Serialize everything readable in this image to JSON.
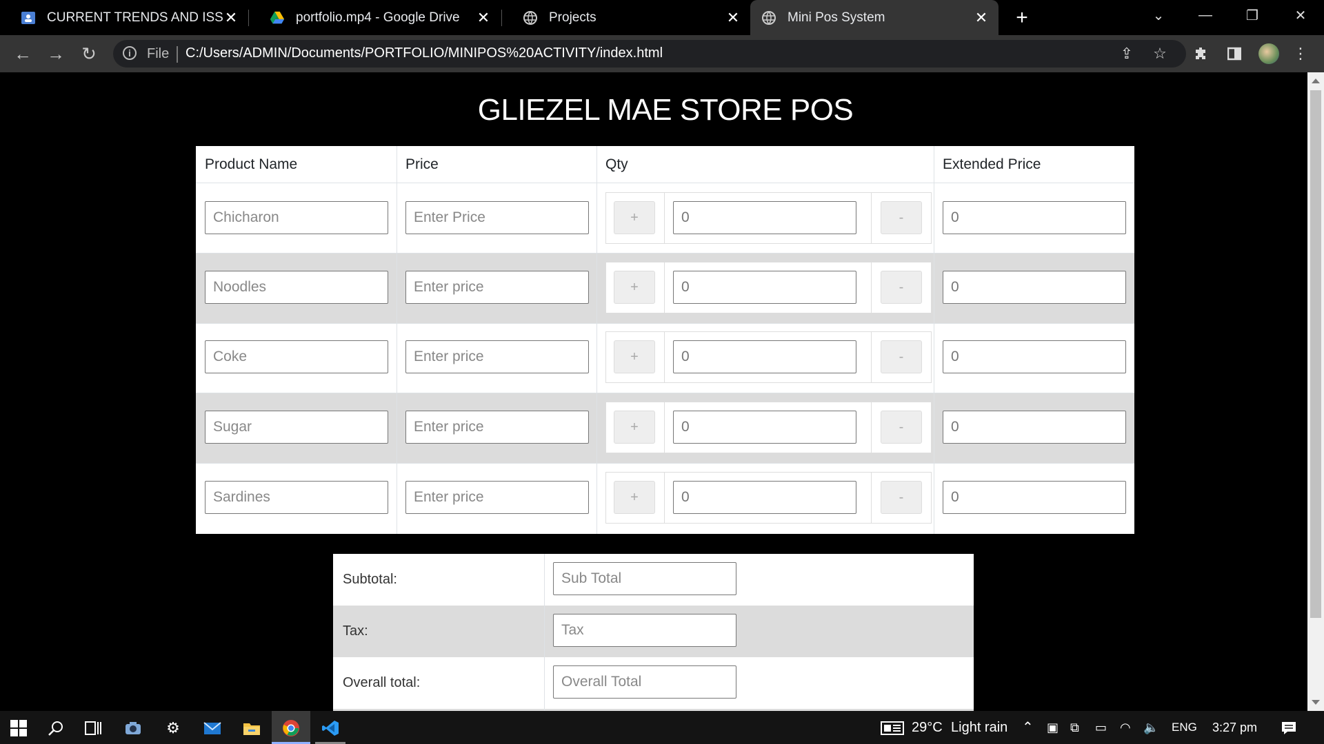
{
  "browser": {
    "tabs": [
      {
        "title": "CURRENT TRENDS AND ISSUES E",
        "icon": "classroom-icon",
        "active": false
      },
      {
        "title": "portfolio.mp4 - Google Drive",
        "icon": "google-drive-icon",
        "active": false
      },
      {
        "title": "Projects",
        "icon": "globe-icon",
        "active": false
      },
      {
        "title": "Mini Pos System",
        "icon": "globe-icon",
        "active": true
      }
    ],
    "address": {
      "scheme_label": "File",
      "url": "C:/Users/ADMIN/Documents/PORTFOLIO/MINIPOS%20ACTIVITY/index.html"
    }
  },
  "page": {
    "title": "GLIEZEL MAE STORE POS",
    "table": {
      "headers": [
        "Product Name",
        "Price",
        "Qty",
        "Extended Price"
      ],
      "rows": [
        {
          "product_placeholder": "Chicharon",
          "price_placeholder": "Enter Price",
          "plus": "+",
          "qty": "0",
          "minus": "-",
          "extended": "0"
        },
        {
          "product_placeholder": "Noodles",
          "price_placeholder": "Enter price",
          "plus": "+",
          "qty": "0",
          "minus": "-",
          "extended": "0"
        },
        {
          "product_placeholder": "Coke",
          "price_placeholder": "Enter price",
          "plus": "+",
          "qty": "0",
          "minus": "-",
          "extended": "0"
        },
        {
          "product_placeholder": "Sugar",
          "price_placeholder": "Enter price",
          "plus": "+",
          "qty": "0",
          "minus": "-",
          "extended": "0"
        },
        {
          "product_placeholder": "Sardines",
          "price_placeholder": "Enter price",
          "plus": "+",
          "qty": "0",
          "minus": "-",
          "extended": "0"
        }
      ]
    },
    "totals": [
      {
        "label": "Subtotal:",
        "placeholder": "Sub Total"
      },
      {
        "label": "Tax:",
        "placeholder": "Tax"
      },
      {
        "label": "Overall total:",
        "placeholder": "Overall Total"
      }
    ]
  },
  "taskbar": {
    "weather_temp": "29°C",
    "weather_desc": "Light rain",
    "language": "ENG",
    "time": "3:27 pm"
  },
  "colors": {
    "accent_vscode": "#2b9bf4",
    "row_shade": "#dcdcdc",
    "tab_active": "#353535"
  }
}
